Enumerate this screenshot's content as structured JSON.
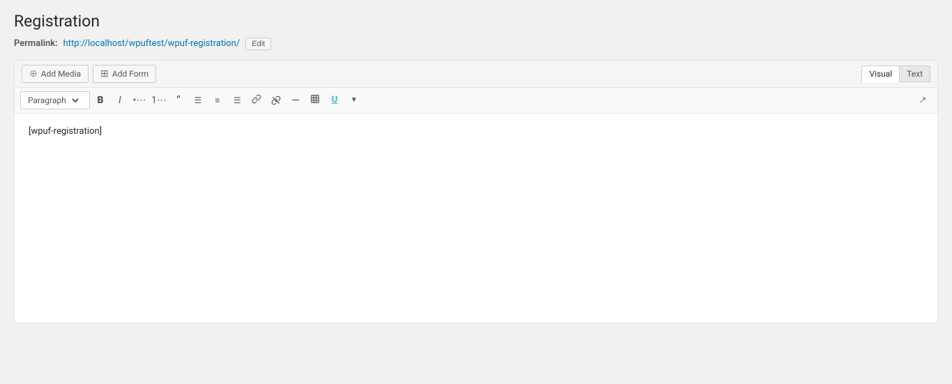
{
  "page": {
    "title": "Registration",
    "permalink_label": "Permalink:",
    "permalink_url": "http://localhost/wpuftest/wpuf-registration/",
    "edit_button": "Edit"
  },
  "editor": {
    "add_media_label": "Add Media",
    "add_form_label": "Add Form",
    "tab_visual": "Visual",
    "tab_text": "Text",
    "paragraph_option": "Paragraph",
    "content": "[wpuf-registration]",
    "toolbar": {
      "bold": "B",
      "italic": "I",
      "unordered_list": "≡",
      "ordered_list": "≡",
      "blockquote": "❝",
      "align_left": "≡",
      "align_center": "≡",
      "align_right": "≡",
      "link": "🔗",
      "unlink": "✂",
      "hr": "—",
      "table": "⊞",
      "more": "↓",
      "expand": "⤢"
    }
  }
}
